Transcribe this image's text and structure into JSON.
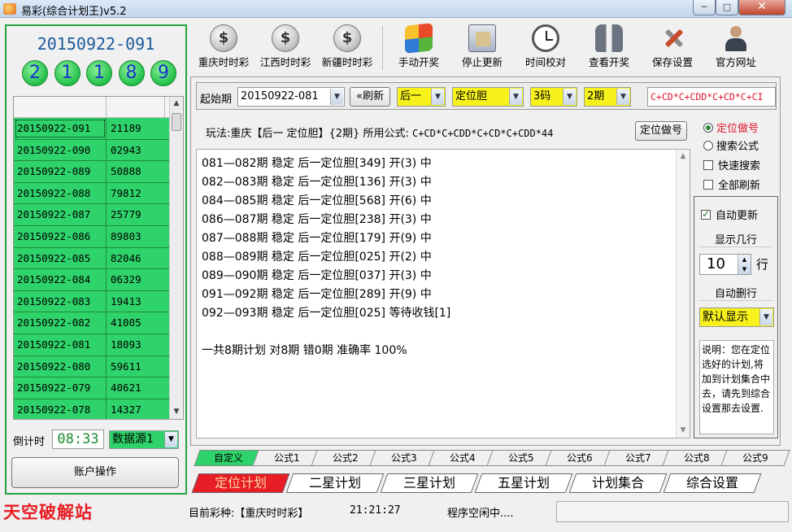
{
  "window": {
    "title": "易彩(综合计划王)v5.2",
    "min_symbol": "─",
    "max_symbol": "□",
    "close_symbol": "✕"
  },
  "left": {
    "current_issue": "20150922-091",
    "balls": [
      "2",
      "1",
      "1",
      "8",
      "9"
    ],
    "history": [
      {
        "issue": "20150922-091",
        "number": "21189"
      },
      {
        "issue": "20150922-090",
        "number": "02943"
      },
      {
        "issue": "20150922-089",
        "number": "50888"
      },
      {
        "issue": "20150922-088",
        "number": "79812"
      },
      {
        "issue": "20150922-087",
        "number": "25779"
      },
      {
        "issue": "20150922-086",
        "number": "89803"
      },
      {
        "issue": "20150922-085",
        "number": "82046"
      },
      {
        "issue": "20150922-084",
        "number": "06329"
      },
      {
        "issue": "20150922-083",
        "number": "19413"
      },
      {
        "issue": "20150922-082",
        "number": "41005"
      },
      {
        "issue": "20150922-081",
        "number": "18093"
      },
      {
        "issue": "20150922-080",
        "number": "59611"
      },
      {
        "issue": "20150922-079",
        "number": "40621"
      },
      {
        "issue": "20150922-078",
        "number": "14327"
      }
    ],
    "countdown_label": "倒计时",
    "countdown": "08:33",
    "source": "数据源1",
    "account_button": "账户操作"
  },
  "toolbar": [
    {
      "label": "重庆时时彩",
      "icon": "coin-icon"
    },
    {
      "label": "江西时时彩",
      "icon": "coin-icon"
    },
    {
      "label": "新疆时时彩",
      "icon": "coin-icon"
    },
    {
      "label": "手动开奖",
      "icon": "windows-flag-icon"
    },
    {
      "label": "停止更新",
      "icon": "film-icon"
    },
    {
      "label": "时间校对",
      "icon": "clock-icon"
    },
    {
      "label": "查看开奖",
      "icon": "binoculars-icon"
    },
    {
      "label": "保存设置",
      "icon": "tools-icon"
    },
    {
      "label": "官方网址",
      "icon": "person-icon"
    }
  ],
  "filter": {
    "start_label": "起始期",
    "start_issue": "20150922-081",
    "refresh_button": "«刷新",
    "position": "后一",
    "method": "定位胆",
    "codes": "3码",
    "periods": "2期",
    "formula": "C+CD*C+CDD*C+CD*C+CI"
  },
  "info": {
    "text": "玩法:重庆【后一 定位胆】{2期} 所用公式:",
    "formula": "C+CD*C+CDD*C+CD*C+CDD*44",
    "button": "定位做号"
  },
  "output": {
    "lines": [
      "081—082期 稳定 后一定位胆[349] 开(3) 中",
      "082—083期 稳定 后一定位胆[136] 开(3) 中",
      "084—085期 稳定 后一定位胆[568] 开(6) 中",
      "086—087期 稳定 后一定位胆[238] 开(3) 中",
      "087—088期 稳定 后一定位胆[179] 开(9) 中",
      "088—089期 稳定 后一定位胆[025] 开(2) 中",
      "089—090期 稳定 后一定位胆[037] 开(3) 中",
      "091—092期 稳定 后一定位胆[289] 开(9) 中",
      "092—093期 稳定 后一定位胆[025] 等待收钱[1]"
    ],
    "summary": "一共8期计划 对8期 错0期 准确率 100%"
  },
  "options": {
    "radio_dingwei": "定位做号",
    "radio_search": "搜索公式",
    "check_quick": "快速搜索",
    "check_refresh_all": "全部刷新",
    "check_auto_update": "自动更新",
    "rows_label": "显示几行",
    "rows_value": "10",
    "rows_unit": "行",
    "auto_delete_label": "自动删行",
    "display_mode": "默认显示",
    "note": "说明：您在定位选好的计划,将加到计划集合中去，请先到综合设置那去设置."
  },
  "formula_tabs": [
    "自定义",
    "公式1",
    "公式2",
    "公式3",
    "公式4",
    "公式5",
    "公式6",
    "公式7",
    "公式8",
    "公式9"
  ],
  "bottom_tabs": [
    "定位计划",
    "二星计划",
    "三星计划",
    "五星计划",
    "计划集合",
    "综合设置"
  ],
  "status": {
    "watermark": "天空破解站",
    "current_label": "目前彩种:【重庆时时彩】",
    "time": "21:21:27",
    "state": "程序空闲中...."
  },
  "colors": {
    "green_accent": "#2fd36b",
    "yellow_combo": "#f7f21c",
    "red_tab": "#e81c24",
    "formula_red": "#e0142a",
    "ball_text": "#1537c9"
  }
}
